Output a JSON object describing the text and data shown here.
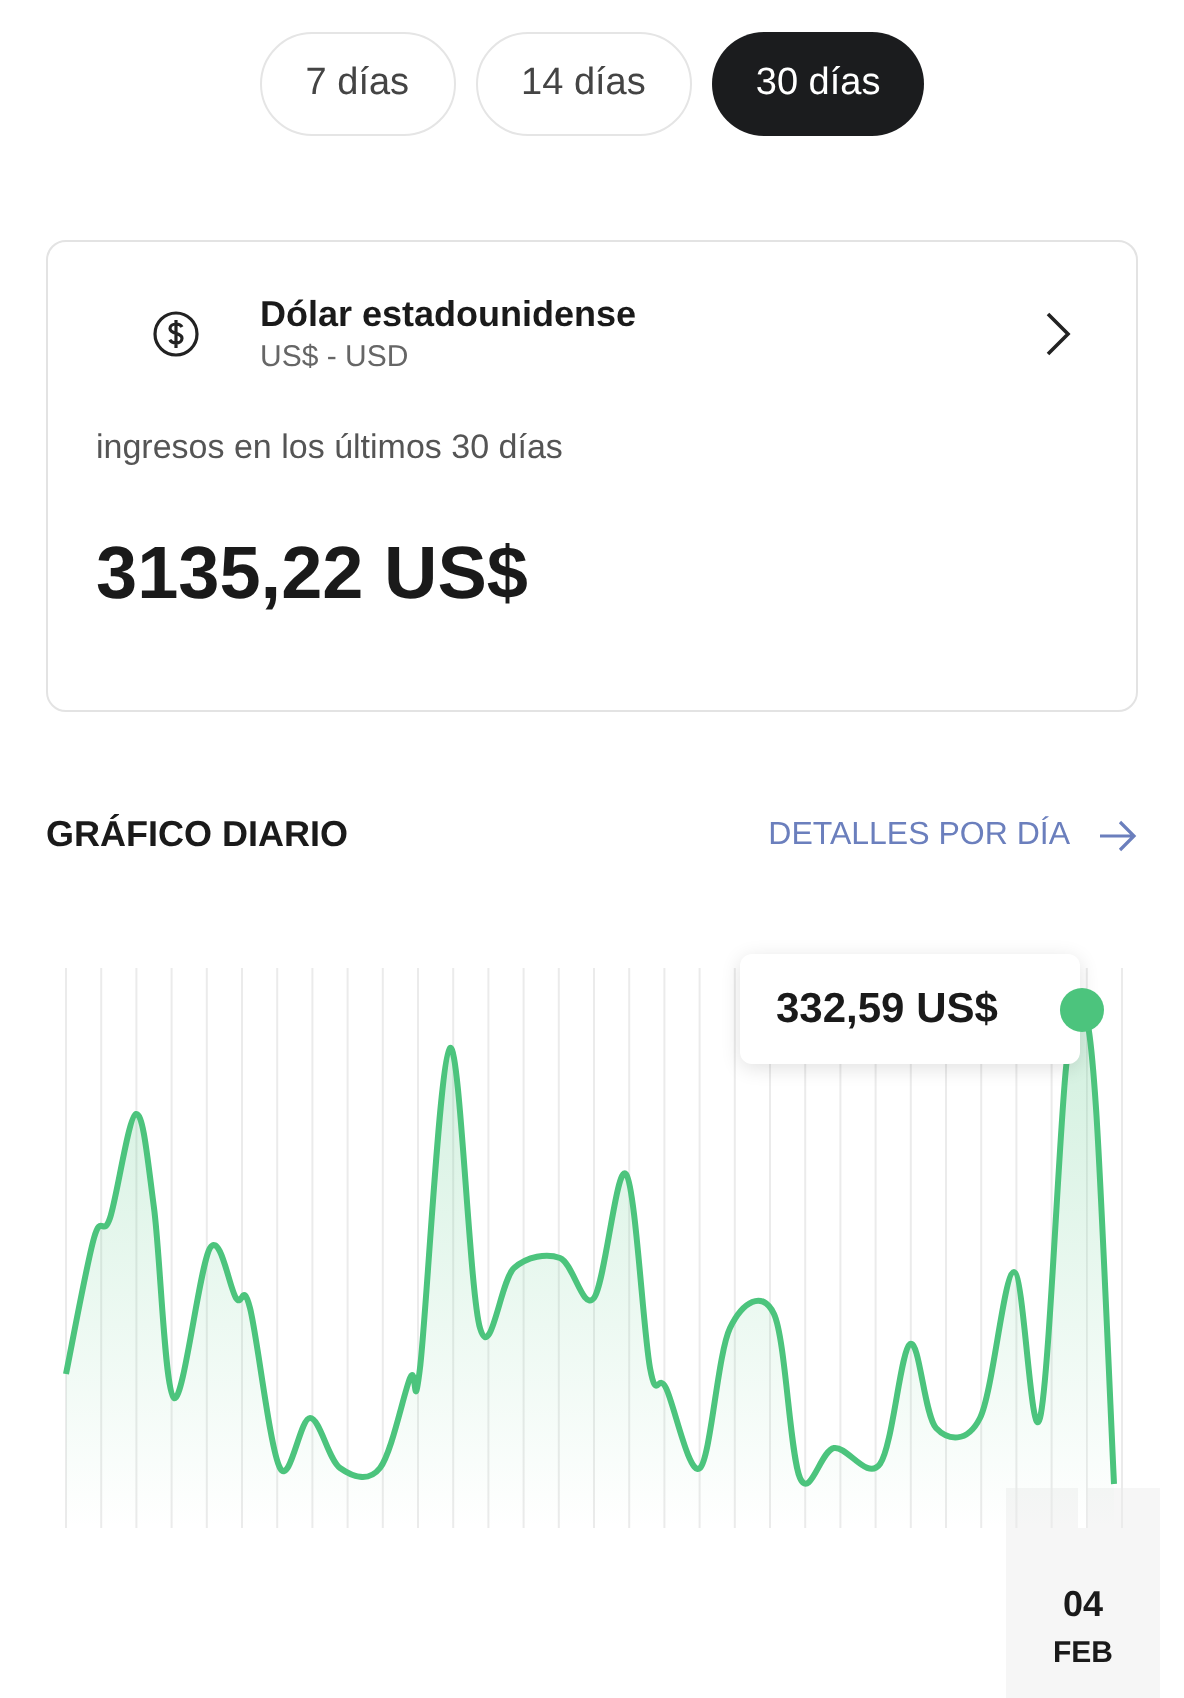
{
  "tabs": [
    {
      "label": "7 días",
      "selected": false
    },
    {
      "label": "14 días",
      "selected": false
    },
    {
      "label": "30 días",
      "selected": true
    }
  ],
  "currency": {
    "name": "Dólar estadounidense",
    "code": "US$ - USD",
    "caption": "ingresos en los últimos 30 días",
    "total": "3135,22 US$"
  },
  "section": {
    "title": "GRÁFICO DIARIO",
    "link": "DETALLES POR DÍA"
  },
  "chart": {
    "tooltip": "332,59 US$",
    "day": "04",
    "month": "FEB"
  }
}
